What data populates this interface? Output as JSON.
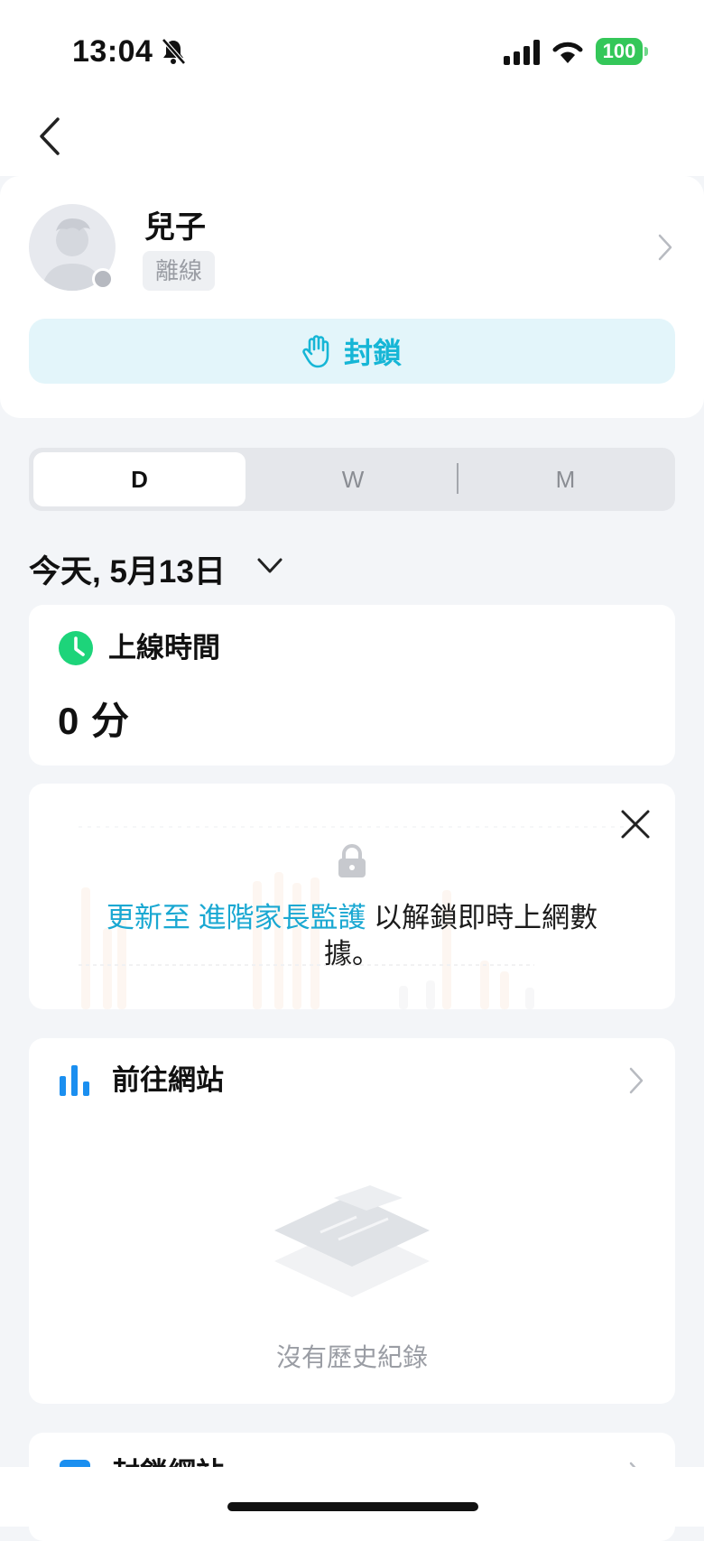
{
  "status_bar": {
    "time": "13:04",
    "battery": "100"
  },
  "profile": {
    "name": "兒子",
    "status": "離線",
    "block_label": "封鎖"
  },
  "tabs": [
    {
      "label": "D",
      "active": true
    },
    {
      "label": "W",
      "active": false
    },
    {
      "label": "M",
      "active": false
    }
  ],
  "date_label": "今天, 5月13日",
  "online_time": {
    "title": "上線時間",
    "value": "0 分"
  },
  "upsell": {
    "link_text": "更新至 進階家長監護",
    "text": " 以解鎖即時上網數據。"
  },
  "sites": {
    "title": "前往網站",
    "empty_text": "沒有歷史紀錄"
  },
  "blocked": {
    "title": "封鎖網站"
  },
  "colors": {
    "accent": "#16b6d6",
    "online_green": "#1dd47a",
    "link": "#1aa8d2",
    "battery": "#34c759"
  }
}
